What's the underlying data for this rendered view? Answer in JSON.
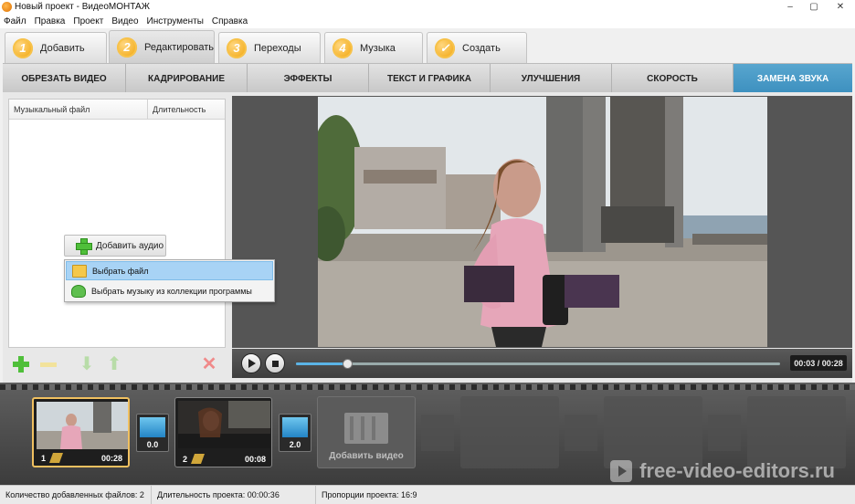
{
  "window": {
    "title": "Новый проект - ВидеоМОНТАЖ"
  },
  "menu": [
    "Файл",
    "Правка",
    "Проект",
    "Видео",
    "Инструменты",
    "Справка"
  ],
  "steps": [
    {
      "num": "1",
      "label": "Добавить"
    },
    {
      "num": "2",
      "label": "Редактировать",
      "active": true
    },
    {
      "num": "3",
      "label": "Переходы"
    },
    {
      "num": "4",
      "label": "Музыка"
    },
    {
      "num": "✓",
      "label": "Создать"
    }
  ],
  "subtabs": [
    "ОБРЕЗАТЬ ВИДЕО",
    "КАДРИРОВАНИЕ",
    "ЭФФЕКТЫ",
    "ТЕКСТ И ГРАФИКА",
    "УЛУЧШЕНИЯ",
    "СКОРОСТЬ",
    "ЗАМЕНА ЗВУКА"
  ],
  "music_panel": {
    "col_file": "Музыкальный файл",
    "col_duration": "Длительность",
    "add_audio": "Добавить аудио",
    "context_menu": [
      "Выбрать файл",
      "Выбрать музыку из коллекции программы"
    ]
  },
  "player": {
    "time": "00:03 / 00:28",
    "progress": 0.107
  },
  "timeline": {
    "clips": [
      {
        "num": "1",
        "duration": "00:28"
      },
      {
        "num": "2",
        "duration": "00:08"
      }
    ],
    "transitions": [
      "0.0",
      "2.0"
    ],
    "add_video": "Добавить видео",
    "watermark": "free-video-editors.ru"
  },
  "status": {
    "files": "Количество добавленных файлов: 2",
    "duration": "Длительность проекта:  00:00:36",
    "ratio": "Пропорции проекта:  16:9"
  },
  "colors": {
    "accent": "#4a9ccb",
    "badge": "#f0a000"
  }
}
